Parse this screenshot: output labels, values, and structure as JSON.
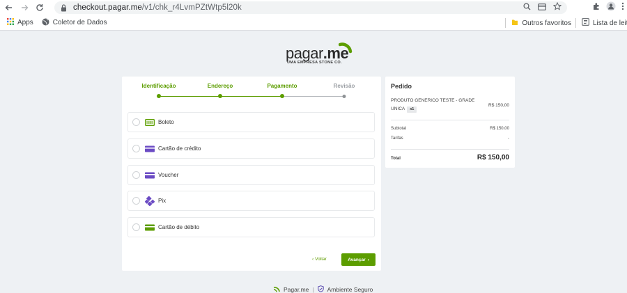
{
  "browser": {
    "url_host": "checkout.pagar.me",
    "url_path": "/v1/chk_r4LvmPZtWtp5l20k"
  },
  "bookmarks": {
    "apps": "Apps",
    "coletor": "Coletor de Dados",
    "outros": "Outros favoritos",
    "leitura": "Lista de leitura"
  },
  "brand": {
    "name_main": "pagar",
    "name_suffix": ".me",
    "subtitle": "UMA EMPRESA STONE CO.",
    "accent": "#5c9d00"
  },
  "steps": [
    {
      "label": "Identificação",
      "state": "done"
    },
    {
      "label": "Endereço",
      "state": "done"
    },
    {
      "label": "Pagamento",
      "state": "current"
    },
    {
      "label": "Revisão",
      "state": "pending"
    }
  ],
  "payment_options": [
    {
      "label": "Boleto",
      "icon": "boleto-icon"
    },
    {
      "label": "Cartão de crédito",
      "icon": "credit-card-icon"
    },
    {
      "label": "Voucher",
      "icon": "voucher-card-icon"
    },
    {
      "label": "Pix",
      "icon": "pix-icon"
    },
    {
      "label": "Cartão de débito",
      "icon": "debit-card-icon"
    }
  ],
  "actions": {
    "back": "Voltar",
    "next": "Avançar"
  },
  "order": {
    "title": "Pedido",
    "product_name": "PRODUTO GENERICO TESTE - GRADE UNICA",
    "quantity": "x1",
    "product_price": "R$ 150,00",
    "subtotal_label": "Subtotal",
    "subtotal_value": "R$ 150,00",
    "fees_label": "Tarifas",
    "fees_value": "-",
    "total_label": "Total",
    "total_value": "R$ 150,00"
  },
  "footer": {
    "brand": "Pagar.me",
    "secure": "Ambiente Seguro"
  }
}
